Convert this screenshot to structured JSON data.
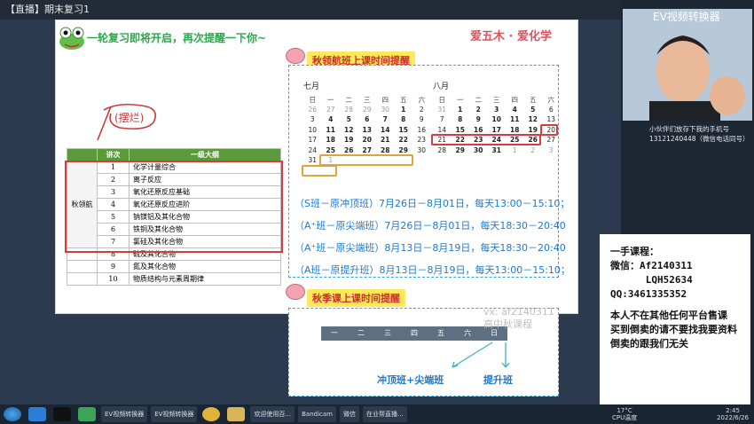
{
  "window": {
    "title": "【直播】期末复习1"
  },
  "slide": {
    "headline": "一轮复习即将开启，再次提醒一下你~",
    "brand": "爱五木 · 爱化学",
    "doodle": "(摆烂)"
  },
  "syllabus": {
    "headers": [
      "讲次",
      "一级大纲"
    ],
    "group_label": "秋领航",
    "rows": [
      {
        "num": "1",
        "topic": "化学计量综合"
      },
      {
        "num": "2",
        "topic": "离子反应"
      },
      {
        "num": "3",
        "topic": "氧化还原反应基础"
      },
      {
        "num": "4",
        "topic": "氧化还原反应进阶"
      },
      {
        "num": "5",
        "topic": "钠镁铝及其化合物"
      },
      {
        "num": "6",
        "topic": "铁铜及其化合物"
      },
      {
        "num": "7",
        "topic": "氯硅及其化合物"
      },
      {
        "num": "8",
        "topic": "硫及其化合物"
      },
      {
        "num": "9",
        "topic": "氮及其化合物"
      },
      {
        "num": "10",
        "topic": "物质结构与元素周期律"
      }
    ]
  },
  "autumn_banner": "秋领航班上课时间提醒",
  "season_banner": "秋季课上课时间提醒",
  "calendar": {
    "weekdays": [
      "日",
      "一",
      "二",
      "三",
      "四",
      "五",
      "六"
    ],
    "july": {
      "label": "七月",
      "rows": [
        [
          "26",
          "27",
          "28",
          "29",
          "30",
          "1",
          "2"
        ],
        [
          "3",
          "4",
          "5",
          "6",
          "7",
          "8",
          "9"
        ],
        [
          "10",
          "11",
          "12",
          "13",
          "14",
          "15",
          "16"
        ],
        [
          "17",
          "18",
          "19",
          "20",
          "21",
          "22",
          "23"
        ],
        [
          "24",
          "25",
          "26",
          "27",
          "28",
          "29",
          "30"
        ],
        [
          "31",
          "1",
          "",
          "",
          "",
          "",
          ""
        ]
      ]
    },
    "august": {
      "label": "八月",
      "rows": [
        [
          "31",
          "1",
          "2",
          "3",
          "4",
          "5",
          "6"
        ],
        [
          "7",
          "8",
          "9",
          "10",
          "11",
          "12",
          "13"
        ],
        [
          "14",
          "15",
          "16",
          "17",
          "18",
          "19",
          "20"
        ],
        [
          "21",
          "22",
          "23",
          "24",
          "25",
          "26",
          "27"
        ],
        [
          "28",
          "29",
          "30",
          "31",
          "1",
          "2",
          "3"
        ]
      ]
    }
  },
  "schedule": [
    "（S班－原冲顶班）7月26日－8月01日，每天13:00－15:10；",
    "（A⁺班－原尖端班）7月26日－8月01日，每天18:30－20:40",
    "（A⁺班－原尖端班）8月13日－8月19日，每天18:30－20:40",
    "（A班－原提升班）8月13日－8月19日，每天13:00－15:10；"
  ],
  "week_bar": [
    "一",
    "二",
    "三",
    "四",
    "五",
    "六",
    "日"
  ],
  "class_tags": {
    "left": "冲顶班+尖端班",
    "right": "提升班"
  },
  "watermark": [
    "vx: af2140311",
    "高中秋课程"
  ],
  "video": {
    "title": "EV视频转换器",
    "chat": "小伙伴们放存下我的手机号13121240448（微信电话同号）"
  },
  "ad_lines": [
    "一手课程：",
    "微信：Af2140311",
    "      LQH52634",
    "QQ:3461335352",
    "",
    "本人不在其他任何平台售课",
    "买到倒卖的请不要找我要资料",
    "倒卖的跟我们无关"
  ],
  "taskbar": {
    "items": [
      "EV视频转换器",
      "EV视频转换器",
      "欢迎使用百...",
      "Bandicam",
      "微信",
      "在业帮直播..."
    ],
    "temp": "17°C",
    "cpu": "CPU温度",
    "time": "2:45",
    "date": "2022/6/26"
  }
}
